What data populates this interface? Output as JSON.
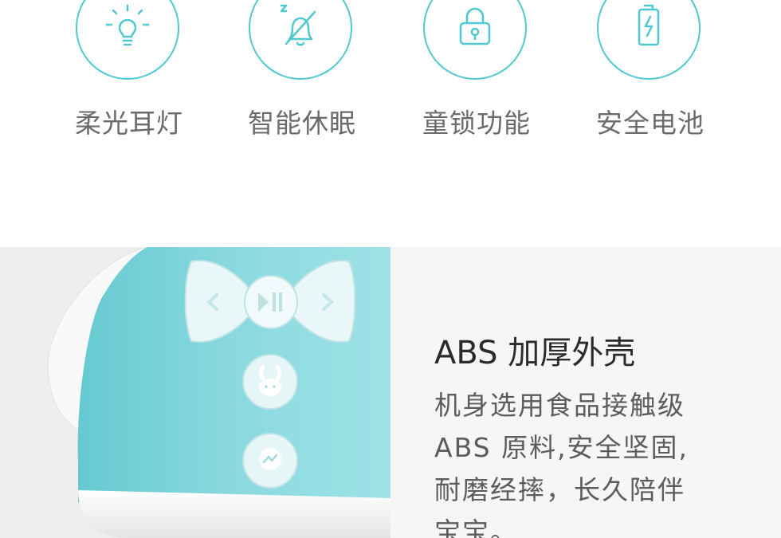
{
  "features": [
    {
      "icon": "light-bulb-icon",
      "label": "柔光耳灯"
    },
    {
      "icon": "bell-off-icon",
      "label": "智能休眠"
    },
    {
      "icon": "lock-icon",
      "label": "童锁功能"
    },
    {
      "icon": "battery-icon",
      "label": "安全电池"
    }
  ],
  "product": {
    "title": "ABS 加厚外壳",
    "description_lines": [
      "机身选用食品接触级",
      "ABS 原料,安全坚固,",
      "耐磨经摔，长久陪伴",
      "宝宝。"
    ]
  },
  "colors": {
    "accent": "#4fc9cf",
    "body": "#8ad9df"
  }
}
